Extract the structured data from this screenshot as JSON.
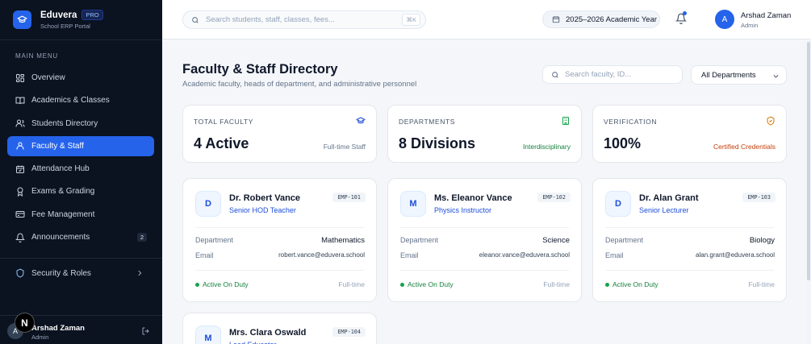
{
  "brand": {
    "name": "Eduvera",
    "badge": "PRO",
    "subtitle": "School ERP Portal"
  },
  "sidebar": {
    "section_title": "MAIN MENU",
    "items": [
      {
        "label": "Overview",
        "icon": "grid-icon"
      },
      {
        "label": "Academics & Classes",
        "icon": "book-icon"
      },
      {
        "label": "Students Directory",
        "icon": "users-icon"
      },
      {
        "label": "Faculty & Staff",
        "icon": "user-icon",
        "active": true
      },
      {
        "label": "Attendance Hub",
        "icon": "calendar-check-icon"
      },
      {
        "label": "Exams & Grading",
        "icon": "award-icon"
      },
      {
        "label": "Fee Management",
        "icon": "card-icon"
      },
      {
        "label": "Announcements",
        "icon": "bell-icon",
        "count": "2"
      }
    ],
    "security_label": "Security & Roles",
    "user": {
      "initial": "A",
      "name": "Arshad Zaman",
      "role": "Admin"
    },
    "overlay_badge": "N"
  },
  "topbar": {
    "search_placeholder": "Search students, staff, classes, fees...",
    "search_shortcut": "⌘K",
    "academic_year": "2025–2026 Academic Year",
    "user": {
      "initial": "A",
      "name": "Arshad Zaman",
      "role": "Admin"
    }
  },
  "page": {
    "title": "Faculty & Staff Directory",
    "subtitle": "Academic faculty, heads of department, and administrative personnel",
    "search_placeholder": "Search faculty, ID...",
    "department_filter": "All Departments"
  },
  "stats": [
    {
      "label": "TOTAL FACULTY",
      "value": "4 Active",
      "note": "Full-time Staff",
      "icon": "graduation-cap-icon",
      "note_color": "#64748b",
      "icon_color": "#1d4ed8"
    },
    {
      "label": "DEPARTMENTS",
      "value": "8 Divisions",
      "note": "Interdisciplinary",
      "icon": "building-icon",
      "note_color": "#15803d",
      "icon_color": "#16a34a"
    },
    {
      "label": "VERIFICATION",
      "value": "100%",
      "note": "Certified Credentials",
      "icon": "shield-check-icon",
      "note_color": "#c2410c",
      "icon_color": "#d97706"
    }
  ],
  "faculty": [
    {
      "initial": "D",
      "name": "Dr. Robert Vance",
      "role": "Senior HOD Teacher",
      "emp_id": "EMP-101",
      "department_label": "Department",
      "department": "Mathematics",
      "email_label": "Email",
      "email": "robert.vance@eduvera.school",
      "status": "Active On Duty",
      "type": "Full-time"
    },
    {
      "initial": "M",
      "name": "Ms. Eleanor Vance",
      "role": "Physics Instructor",
      "emp_id": "EMP-102",
      "department_label": "Department",
      "department": "Science",
      "email_label": "Email",
      "email": "eleanor.vance@eduvera.school",
      "status": "Active On Duty",
      "type": "Full-time"
    },
    {
      "initial": "D",
      "name": "Dr. Alan Grant",
      "role": "Senior Lecturer",
      "emp_id": "EMP-103",
      "department_label": "Department",
      "department": "Biology",
      "email_label": "Email",
      "email": "alan.grant@eduvera.school",
      "status": "Active On Duty",
      "type": "Full-time"
    },
    {
      "initial": "M",
      "name": "Mrs. Clara Oswald",
      "role": "Lead Educator",
      "emp_id": "EMP-104"
    }
  ]
}
